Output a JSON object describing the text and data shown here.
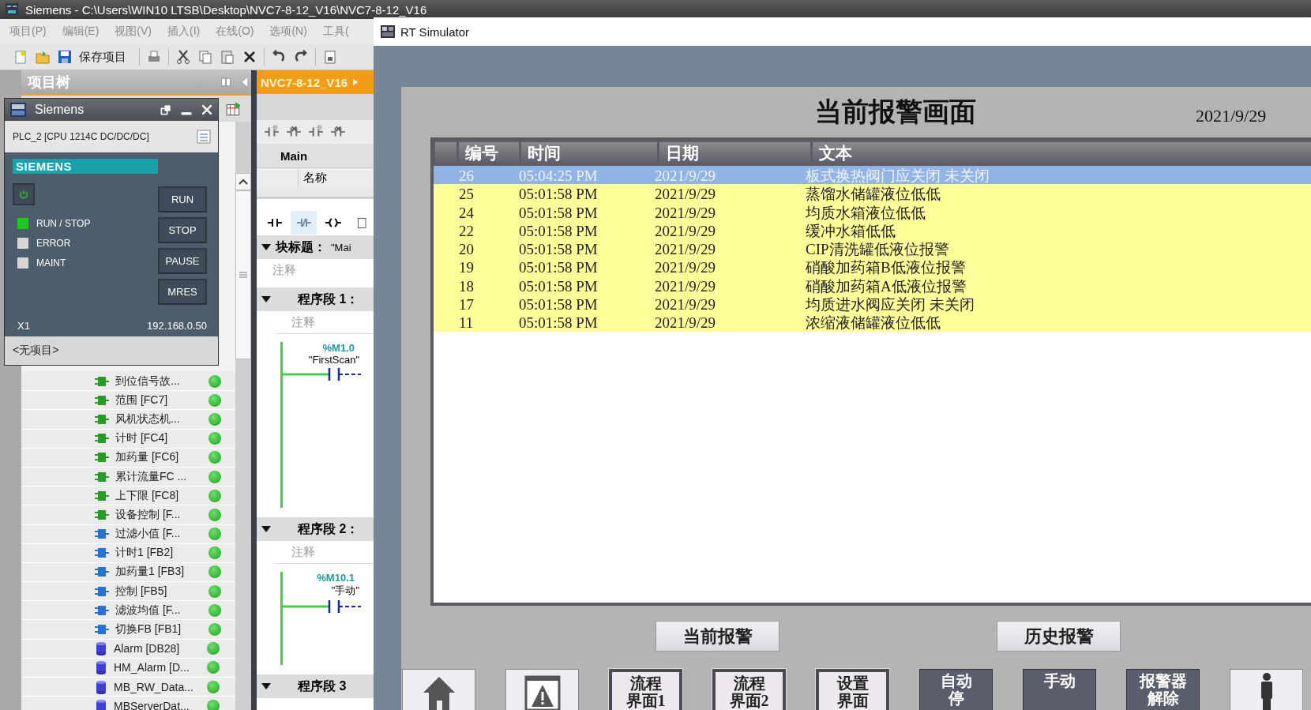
{
  "tia": {
    "title": "Siemens  -  C:\\Users\\WIN10 LTSB\\Desktop\\NVC7-8-12_V16\\NVC7-8-12_V16",
    "menu": [
      "项目(P)",
      "编辑(E)",
      "视图(V)",
      "插入(I)",
      "在线(O)",
      "选项(N)",
      "工具("
    ],
    "save_label": "保存项目",
    "project_tree": {
      "title": "项目树",
      "items": [
        {
          "kind": "fc",
          "label": "到位信号故..."
        },
        {
          "kind": "fc",
          "label": "范围 [FC7]"
        },
        {
          "kind": "fc",
          "label": "风机状态机..."
        },
        {
          "kind": "fc",
          "label": "计时 [FC4]"
        },
        {
          "kind": "fc",
          "label": "加药量 [FC6]"
        },
        {
          "kind": "fc",
          "label": "累计流量FC ..."
        },
        {
          "kind": "fc",
          "label": "上下限 [FC8]"
        },
        {
          "kind": "fc",
          "label": "设备控制 [F..."
        },
        {
          "kind": "fb",
          "label": "过滤小值 [F..."
        },
        {
          "kind": "fb",
          "label": "计时1 [FB2]"
        },
        {
          "kind": "fb",
          "label": "加药量1 [FB3]"
        },
        {
          "kind": "fb",
          "label": "控制 [FB5]"
        },
        {
          "kind": "fb",
          "label": "滤波均值 [F..."
        },
        {
          "kind": "fb",
          "label": "切换FB [FB1]"
        },
        {
          "kind": "db",
          "label": "Alarm [DB28]"
        },
        {
          "kind": "db",
          "label": "HM_Alarm [D..."
        },
        {
          "kind": "db",
          "label": "MB_RW_Data..."
        },
        {
          "kind": "db",
          "label": "MBServerDat..."
        }
      ]
    },
    "editor": {
      "tab": "NVC7-8-12_V16",
      "block": "Main",
      "column": "名称",
      "block_title_label": "块标题：",
      "block_title_value": "\"Mai",
      "block_comment": "注释",
      "segments": [
        {
          "title": "程序段 1：",
          "comment": "注释",
          "address": "%M1.0",
          "tag": "\"FirstScan\""
        },
        {
          "title": "程序段 2：",
          "comment": "注释",
          "address": "%M10.1",
          "tag": "\"手动\""
        },
        {
          "title": "程序段 3"
        }
      ]
    }
  },
  "plcsim": {
    "title": "Siemens",
    "cpu": "PLC_2 [CPU 1214C DC/DC/DC]",
    "brand": "SIEMENS",
    "leds": [
      {
        "label": "RUN / STOP",
        "on": true
      },
      {
        "label": "ERROR",
        "on": false
      },
      {
        "label": "MAINT",
        "on": false
      }
    ],
    "buttons": [
      "RUN",
      "STOP",
      "PAUSE",
      "MRES"
    ],
    "port": "X1",
    "ip": "192.168.0.50",
    "project": "<无项目>"
  },
  "rt": {
    "title": "RT Simulator",
    "screen_title": "当前报警画面",
    "date": "2021/9/29",
    "columns": [
      "编号",
      "时间",
      "日期",
      "文本"
    ],
    "rows": [
      {
        "no": "26",
        "time": "05:04:25 PM",
        "date": "2021/9/29",
        "text": "板式换热阀门应关闭 未关闭",
        "selected": true
      },
      {
        "no": "25",
        "time": "05:01:58 PM",
        "date": "2021/9/29",
        "text": "蒸馏水储罐液位低低",
        "selected": false
      },
      {
        "no": "24",
        "time": "05:01:58 PM",
        "date": "2021/9/29",
        "text": "均质水箱液位低低",
        "selected": false
      },
      {
        "no": "22",
        "time": "05:01:58 PM",
        "date": "2021/9/29",
        "text": "缓冲水箱低低",
        "selected": false
      },
      {
        "no": "20",
        "time": "05:01:58 PM",
        "date": "2021/9/29",
        "text": "CIP清洗罐低液位报警",
        "selected": false
      },
      {
        "no": "19",
        "time": "05:01:58 PM",
        "date": "2021/9/29",
        "text": "硝酸加药箱B低液位报警",
        "selected": false
      },
      {
        "no": "18",
        "time": "05:01:58 PM",
        "date": "2021/9/29",
        "text": "硝酸加药箱A低液位报警",
        "selected": false
      },
      {
        "no": "17",
        "time": "05:01:58 PM",
        "date": "2021/9/29",
        "text": "均质进水阀应关闭 未关闭",
        "selected": false
      },
      {
        "no": "11",
        "time": "05:01:58 PM",
        "date": "2021/9/29",
        "text": "浓缩液储罐液位低低",
        "selected": false
      }
    ],
    "alarm_buttons": [
      "当前报警",
      "历史报警"
    ],
    "nav": [
      {
        "kind": "home"
      },
      {
        "kind": "warning"
      },
      {
        "kind": "nav",
        "lines": [
          "流程",
          "界面1"
        ]
      },
      {
        "kind": "nav",
        "lines": [
          "流程",
          "界面2"
        ]
      },
      {
        "kind": "nav",
        "lines": [
          "设置",
          "界面"
        ]
      },
      {
        "kind": "action",
        "lines": [
          "自动",
          "停"
        ]
      },
      {
        "kind": "action",
        "lines": [
          "手动"
        ]
      },
      {
        "kind": "action",
        "lines": [
          "报警器",
          "解除"
        ]
      },
      {
        "kind": "person"
      }
    ]
  }
}
